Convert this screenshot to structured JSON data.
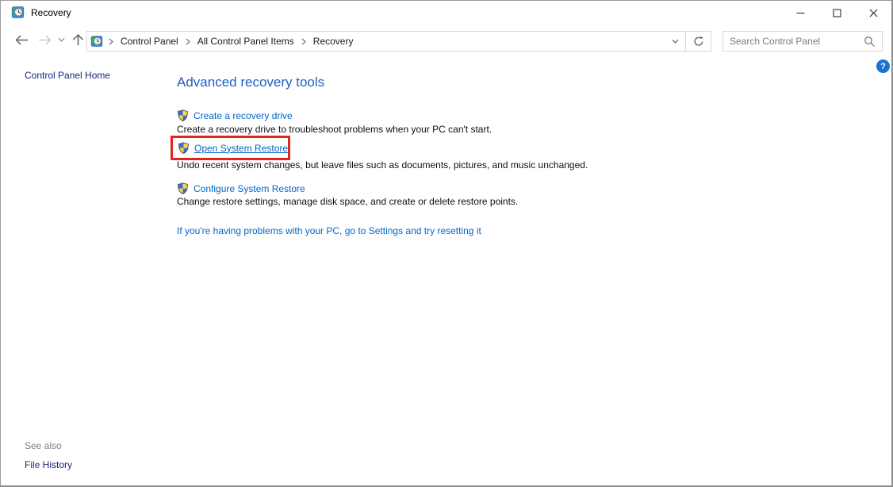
{
  "window": {
    "title": "Recovery"
  },
  "navbar": {
    "breadcrumb_items": [
      "Control Panel",
      "All Control Panel Items",
      "Recovery"
    ],
    "search": {
      "placeholder": "Search Control Panel",
      "value": ""
    }
  },
  "sidebar": {
    "home_label": "Control Panel Home",
    "see_also_label": "See also",
    "items": [
      {
        "label": "File History"
      }
    ]
  },
  "main": {
    "heading": "Advanced recovery tools",
    "tasks": [
      {
        "label": "Create a recovery drive",
        "description": "Create a recovery drive to troubleshoot problems when your PC can't start.",
        "highlighted": false
      },
      {
        "label": "Open System Restore",
        "description": "Undo recent system changes, but leave files such as documents, pictures, and music unchanged.",
        "highlighted": true
      },
      {
        "label": "Configure System Restore",
        "description": "Change restore settings, manage disk space, and create or delete restore points.",
        "highlighted": false
      }
    ],
    "settings_link": "If you're having problems with your PC, go to Settings and try resetting it",
    "help_label": "?"
  },
  "icons": {
    "app": "recovery-clock-with-green-arrow",
    "tasks": "uac-shield-blue-yellow",
    "nav": [
      "back-arrow",
      "forward-arrow",
      "recent-pages-chevron",
      "up-arrow"
    ],
    "address": [
      "dropdown-chevron",
      "refresh"
    ],
    "search": "magnifier",
    "titlebar": [
      "minimize",
      "maximize",
      "close"
    ]
  },
  "colors": {
    "link_blue": "#0066cc",
    "heading_blue": "#1d5fc4",
    "sidebar_navy": "#1b2380",
    "highlight_red": "#e1251b",
    "help_blue": "#1873d3",
    "muted_gray": "#808080",
    "border_gray": "#d9d9d9"
  }
}
